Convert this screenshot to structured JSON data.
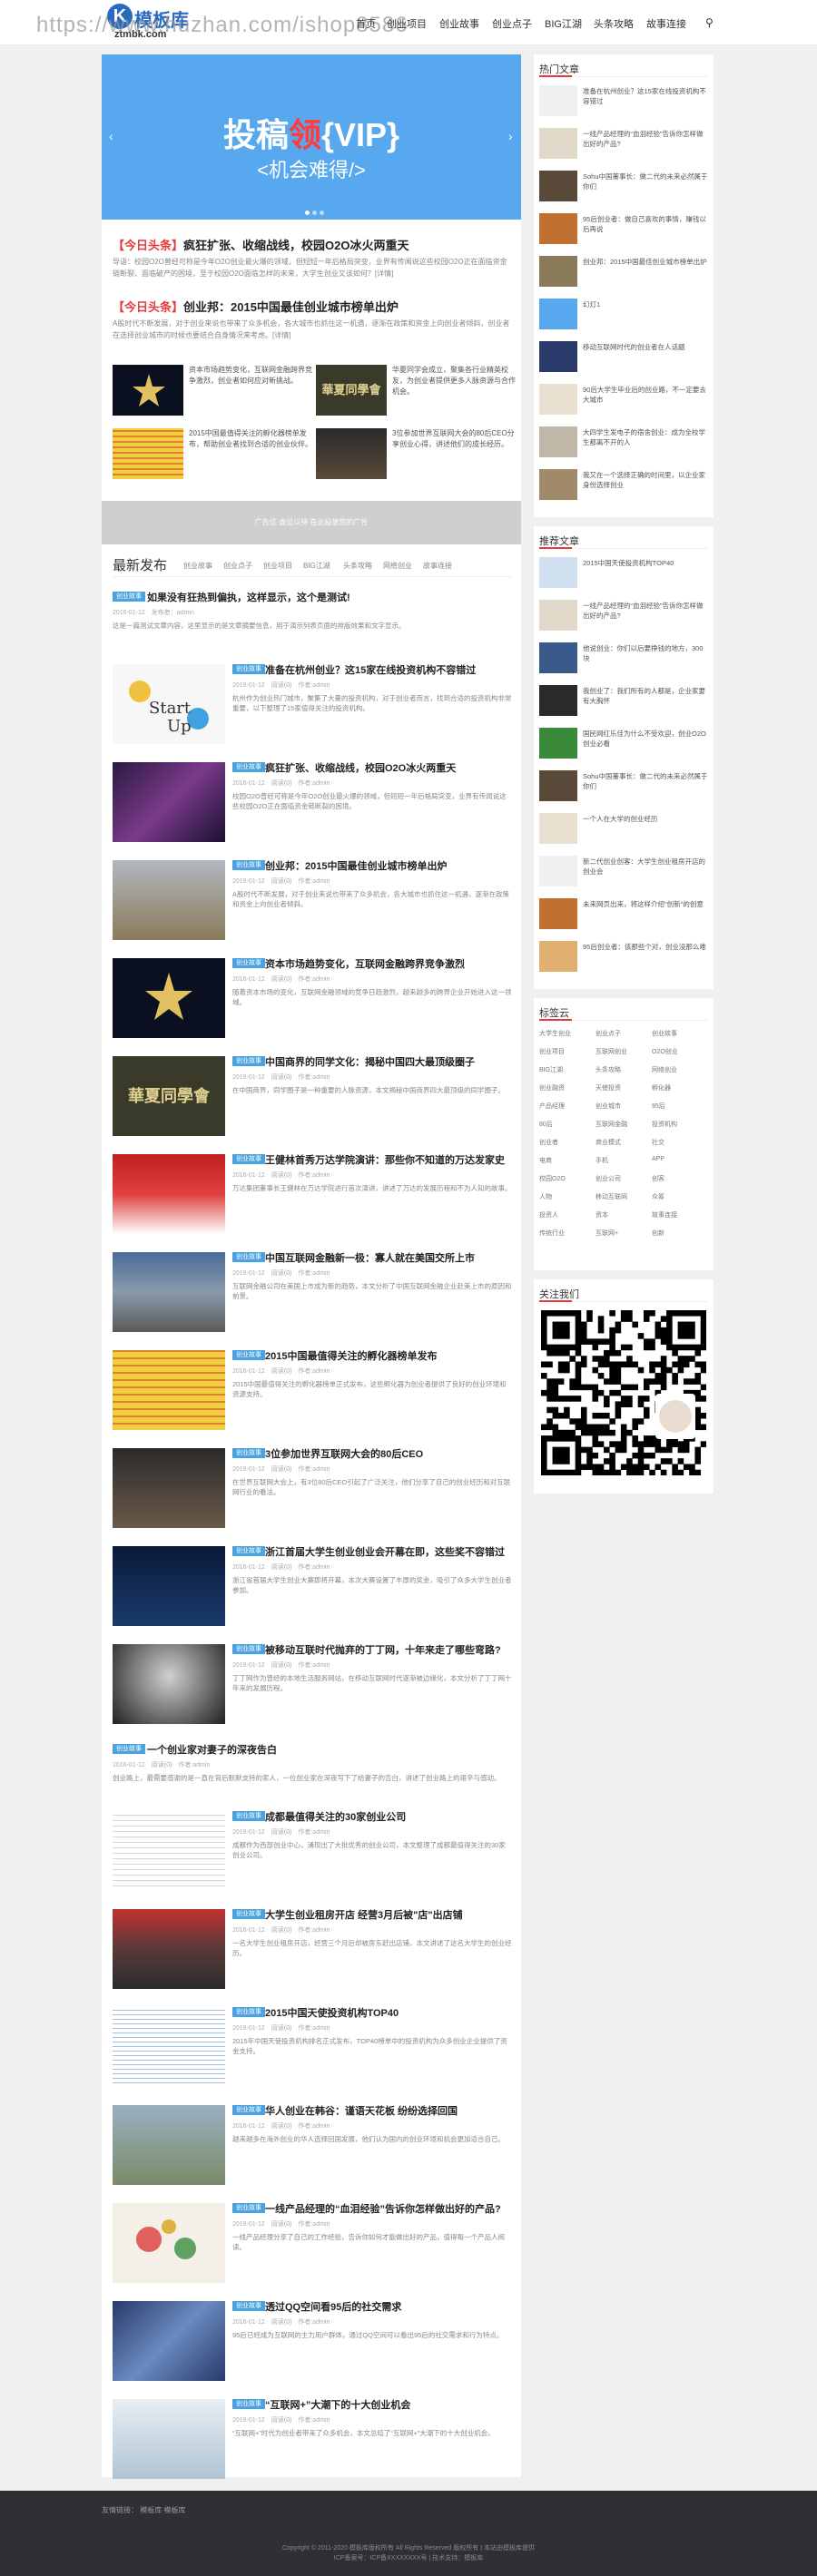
{
  "watermark": "https://www.huzhan.com/ishop8586",
  "logo": {
    "mark": "K",
    "name": "模板库",
    "domain": "ztmbk.com"
  },
  "nav": {
    "items": [
      "首页",
      "创业项目",
      "创业故事",
      "创业点子",
      "BIG江湖",
      "头条攻略",
      "故事连接"
    ]
  },
  "slider": {
    "title_pre": "投稿",
    "title_hl": "领",
    "title_post": "{VIP}",
    "subtitle": "<机会难得/>"
  },
  "headlines": [
    {
      "prefix": "【今日头条】",
      "title": "疯狂扩张、收缩战线，校园O2O冰火两重天",
      "desc": "导语：校园O2O曾经可称是今年O2O创业最火爆的领域，但短短一年后格局突变，业界有传闻说这些校园O2O正在面临资金链断裂、面临破产的困境，至于校园O2O面临怎样的未来，大学生创业又该如何？[详情]"
    },
    {
      "prefix": "【今日头条】",
      "title": "创业邦：2015中国最佳创业城市榜单出炉",
      "desc": "A股时代不断发展，对于创业来说也带来了众多机会，各大城市也抓住这一机遇，逐渐在政策和资金上向创业者倾斜，创业者在选择创业城市的时候也要结合自身情况来考虑。[详情]"
    }
  ],
  "cards": [
    "资本市场趋势变化，互联网金融跨界竞争激烈，创业者如何应对新挑战。",
    "华夏同学会成立，聚集各行业精英校友，为创业者提供更多人脉资源与合作机会。",
    "2015中国最值得关注的孵化器榜单发布，帮助创业者找到合适的创业伙伴。",
    "3位参加世界互联网大会的80后CEO分享创业心得，讲述他们的成长经历。"
  ],
  "ad_bar": "广告位·虚位以待 在此投放您的广告",
  "latest": {
    "heading": "最新发布",
    "tabs": [
      "创业故事",
      "创业点子",
      "创业项目",
      "BIG江湖",
      "头条攻略",
      "网络创业",
      "故事连接"
    ]
  },
  "articles": [
    {
      "tag": "创业故事",
      "title": "如果没有狂热到偏执，这样显示，这个是测试!",
      "meta": "2016-01-12　发布者：admin",
      "desc": "这是一篇测试文章内容，这里显示的是文章摘要信息，用于演示列表页面的排版效果和文字显示。"
    },
    {
      "tag": "创业故事",
      "title": "准备在杭州创业？这15家在线投资机构不容错过",
      "meta": "2016-01-12　阅读(0)　作者:admin",
      "desc": "杭州作为创业热门城市，聚集了大量的投资机构，对于创业者而言，找到合适的投资机构非常重要，以下整理了15家值得关注的投资机构。"
    },
    {
      "tag": "创业故事",
      "title": "疯狂扩张、收缩战线，校园O2O冰火两重天",
      "meta": "2016-01-12　阅读(0)　作者:admin",
      "desc": "校园O2O曾经可称是今年O2O创业最火爆的领域，但短短一年后格局突变，业界有传闻说这些校园O2O正在面临资金链断裂的困境。"
    },
    {
      "tag": "创业故事",
      "title": "创业邦：2015中国最佳创业城市榜单出炉",
      "meta": "2016-01-12　阅读(0)　作者:admin",
      "desc": "A股时代不断发展，对于创业来说也带来了众多机会，各大城市也抓住这一机遇，逐渐在政策和资金上向创业者倾斜。"
    },
    {
      "tag": "创业故事",
      "title": "资本市场趋势变化，互联网金融跨界竞争激烈",
      "meta": "2016-01-12　阅读(0)　作者:admin",
      "desc": "随着资本市场的变化，互联网金融领域的竞争日趋激烈，越来越多的跨界企业开始进入这一领域。"
    },
    {
      "tag": "创业故事",
      "title": "中国商界的同学文化：揭秘中国四大最顶级圈子",
      "meta": "2016-01-12　阅读(0)　作者:admin",
      "desc": "在中国商界，同学圈子是一种重要的人脉资源，本文揭秘中国商界四大最顶级的同学圈子。"
    },
    {
      "tag": "创业故事",
      "title": "王健林首秀万达学院演讲：那些你不知道的万达发家史",
      "meta": "2016-01-12　阅读(0)　作者:admin",
      "desc": "万达集团董事长王健林在万达学院进行首次演讲，讲述了万达的发展历程和不为人知的故事。"
    },
    {
      "tag": "创业故事",
      "title": "中国互联网金融新一极：寡人就在美国交所上市",
      "meta": "2016-01-12　阅读(0)　作者:admin",
      "desc": "互联网金融公司在美国上市成为新的趋势，本文分析了中国互联网金融企业赴美上市的原因和前景。"
    },
    {
      "tag": "创业故事",
      "title": "2015中国最值得关注的孵化器榜单发布",
      "meta": "2016-01-12　阅读(0)　作者:admin",
      "desc": "2015中国最值得关注的孵化器榜单正式发布，这些孵化器为创业者提供了良好的创业环境和资源支持。"
    },
    {
      "tag": "创业故事",
      "title": "3位参加世界互联网大会的80后CEO",
      "meta": "2016-01-12　阅读(0)　作者:admin",
      "desc": "在世界互联网大会上，有3位80后CEO引起了广泛关注，他们分享了自己的创业经历和对互联网行业的看法。"
    },
    {
      "tag": "创业故事",
      "title": "浙江首届大学生创业创业会开幕在即，这些奖不容错过",
      "meta": "2016-01-12　阅读(0)　作者:admin",
      "desc": "浙江省首届大学生创业大赛即将开幕，本次大赛设置了丰厚的奖金，吸引了众多大学生创业者参加。"
    },
    {
      "tag": "创业故事",
      "title": "被移动互联时代抛弃的丁丁网，十年来走了哪些弯路?",
      "meta": "2016-01-12　阅读(0)　作者:admin",
      "desc": "丁丁网作为曾经的本地生活服务网站，在移动互联网时代逐渐被边缘化，本文分析了丁丁网十年来的发展历程。"
    }
  ],
  "text_article": {
    "tag": "创业故事",
    "title": "一个创业家对妻子的深夜告白",
    "meta": "2016-01-12　阅读(0)　作者:admin",
    "desc": "创业路上，最需要感谢的是一直在背后默默支持的家人，一位创业家在深夜写下了给妻子的告白，讲述了创业路上的艰辛与感动。"
  },
  "articles2": [
    {
      "tag": "创业故事",
      "title": "成都最值得关注的30家创业公司",
      "meta": "2016-01-12　阅读(0)　作者:admin",
      "desc": "成都作为西部创业中心，涌现出了大批优秀的创业公司，本文整理了成都最值得关注的30家创业公司。"
    },
    {
      "tag": "创业故事",
      "title": "大学生创业租房开店 经营3月后被\"店\"出店铺",
      "meta": "2016-01-12　阅读(0)　作者:admin",
      "desc": "一名大学生创业租房开店，经营三个月后却被房东赶出店铺，本文讲述了这名大学生的创业经历。"
    },
    {
      "tag": "创业故事",
      "title": "2015中国天使投资机构TOP40",
      "meta": "2016-01-12　阅读(0)　作者:admin",
      "desc": "2015年中国天使投资机构排名正式发布，TOP40榜单中的投资机构为众多创业企业提供了资金支持。"
    },
    {
      "tag": "创业故事",
      "title": "华人创业在韩谷：谨语天花板 纷纷选择回国",
      "meta": "2016-01-12　阅读(0)　作者:admin",
      "desc": "越来越多在海外创业的华人选择回国发展，他们认为国内的创业环境和机会更加适合自己。"
    },
    {
      "tag": "创业故事",
      "title": "一线产品经理的“血泪经验”告诉你怎样做出好的产品?",
      "meta": "2016-01-12　阅读(0)　作者:admin",
      "desc": "一线产品经理分享了自己的工作经验，告诉你如何才能做出好的产品，值得每一个产品人阅读。"
    },
    {
      "tag": "创业故事",
      "title": "透过QQ空间看95后的社交需求",
      "meta": "2016-01-12　阅读(0)　作者:admin",
      "desc": "95后已经成为互联网的主力用户群体，通过QQ空间可以看出95后的社交需求和行为特点。"
    },
    {
      "tag": "创业故事",
      "title": "“互联网+”大潮下的十大创业机会",
      "meta": "2016-01-12　阅读(0)　作者:admin",
      "desc": "“互联网+”时代为创业者带来了众多机会，本文总结了“互联网+”大潮下的十大创业机会。"
    }
  ],
  "sidebar": {
    "hot_heading": "热门文章",
    "hot": [
      "准备在杭州创业？这15家在线投资机构不容错过",
      "一线产品经理的“血泪经验”告诉你怎样做出好的产品?",
      "Sohu中国董事长：做二代的未来必然属于你们",
      "95后创业者：做自己喜欢的事情，赚钱以后再说",
      "创业邦：2015中国最佳创业城市榜单出炉",
      "幻灯1",
      "移动互联网时代的创业者在人话题",
      "90后大学生毕业后的创业路，不一定要去大城市",
      "大四学生发电子的宿舍创业：成为全校学生都离不开的人",
      "我又在一个选择正确的时间里，以企业家身份选择创业"
    ],
    "rec_heading": "推荐文章",
    "rec": [
      "2015中国天使投资机构TOP40",
      "一线产品经理的“血泪经验”告诉你怎样做出好的产品?",
      "他说创业：你们以后要挣钱的地方，300块",
      "我创业了：我们所有的人都是，企业家要有大胸怀",
      "国民网红乐佳为什么不受欢迎，创业O2O创业必看",
      "Sohu中国董事长：做二代的未来必然属于你们",
      "一个人在大学的创业经历",
      "新二代创业创客：大学生创业租房开店的创业会",
      "未来网页出来，将这样介绍\"创新\"的创意",
      "95后创业者：该那些个对，创业没那么难"
    ],
    "tags_heading": "标签云",
    "tags": [
      "大学生创业",
      "创业点子",
      "创业故事",
      "创业项目",
      "互联网创业",
      "O2O创业",
      "BIG江湖",
      "头条攻略",
      "网络创业",
      "创业融资",
      "天使投资",
      "孵化器",
      "产品经理",
      "创业城市",
      "95后",
      "80后",
      "互联网金融",
      "投资机构",
      "创业者",
      "商业模式",
      "社交",
      "电商",
      "手机",
      "APP",
      "校园O2O",
      "创业公司",
      "创客",
      "人物",
      "移动互联网",
      "众筹",
      "投资人",
      "资本",
      "故事连接",
      "传统行业",
      "互联网+",
      "创新"
    ],
    "follow_heading": "关注我们"
  },
  "footer": {
    "links": "友情链接：  模板库   模板库",
    "copy1": "Copyright © 2011-2020 模板库版权所有 All Rights Reserved 版权所有 | 本站由模板库提供",
    "copy2": "ICP备案号：ICP备XXXXXXXX号 | 技术支持：模板库"
  }
}
